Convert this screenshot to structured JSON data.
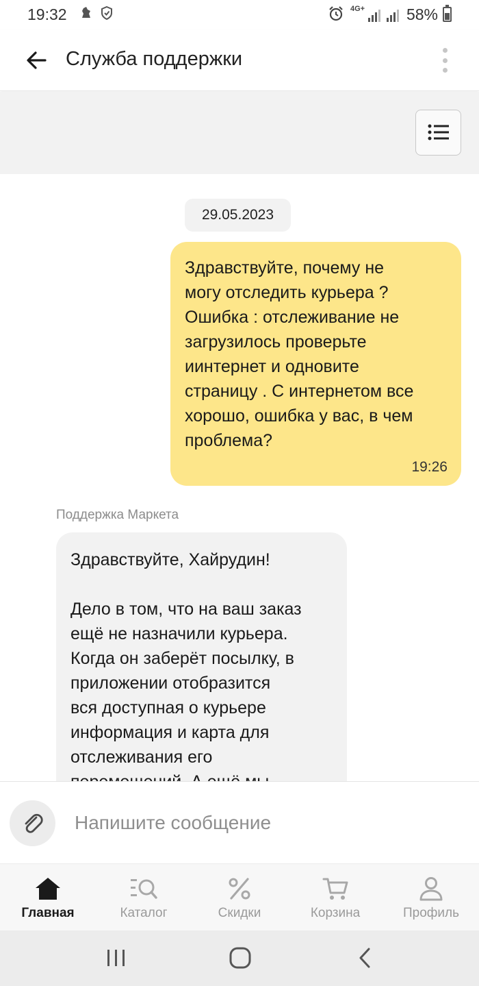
{
  "status_bar": {
    "time": "19:32",
    "network": "4G+",
    "battery": "58%",
    "icons": [
      "notification-icon",
      "shield-icon",
      "alarm-icon",
      "signal-icon",
      "battery-icon"
    ]
  },
  "app_bar": {
    "title": "Служба поддержки",
    "back_icon": "arrow-left-icon",
    "menu_icon": "more-vertical-icon"
  },
  "toolbar": {
    "list_icon": "list-icon"
  },
  "chat": {
    "date": "29.05.2023",
    "messages": [
      {
        "direction": "outgoing",
        "text": "Здравствуйте, почему не\nмогу отследить курьера ?\nОшибка : отслеживание не\nзагрузилось проверьте\nиинтернет и одновите\nстраницу . С интернетом все\nхорошо, ошибка у вас, в чем\nпроблема?",
        "time": "19:26",
        "color": "#fde68a"
      },
      {
        "direction": "incoming",
        "sender": "Поддержка Маркета",
        "text": "Здравствуйте, Хайрудин!\n\nДело в том, что на ваш заказ\nещё не назначили курьера.\nКогда он заберёт посылку, в\nприложении отобразится\nвся доступная о курьере\nинформация и карта для\nотслеживания его\nперемещений. А ещё мы",
        "color": "#f2f2f2"
      }
    ]
  },
  "composer": {
    "placeholder": "Напишите сообщение",
    "value": "",
    "attach_icon": "paperclip-icon"
  },
  "bottom_nav": {
    "items": [
      {
        "label": "Главная",
        "icon": "home-icon",
        "active": true
      },
      {
        "label": "Каталог",
        "icon": "catalog-search-icon",
        "active": false
      },
      {
        "label": "Скидки",
        "icon": "percent-icon",
        "active": false
      },
      {
        "label": "Корзина",
        "icon": "cart-icon",
        "active": false
      },
      {
        "label": "Профиль",
        "icon": "profile-icon",
        "active": false
      }
    ]
  },
  "system_nav": {
    "icons": [
      "recents-icon",
      "home-circle-icon",
      "back-chevron-icon"
    ]
  }
}
